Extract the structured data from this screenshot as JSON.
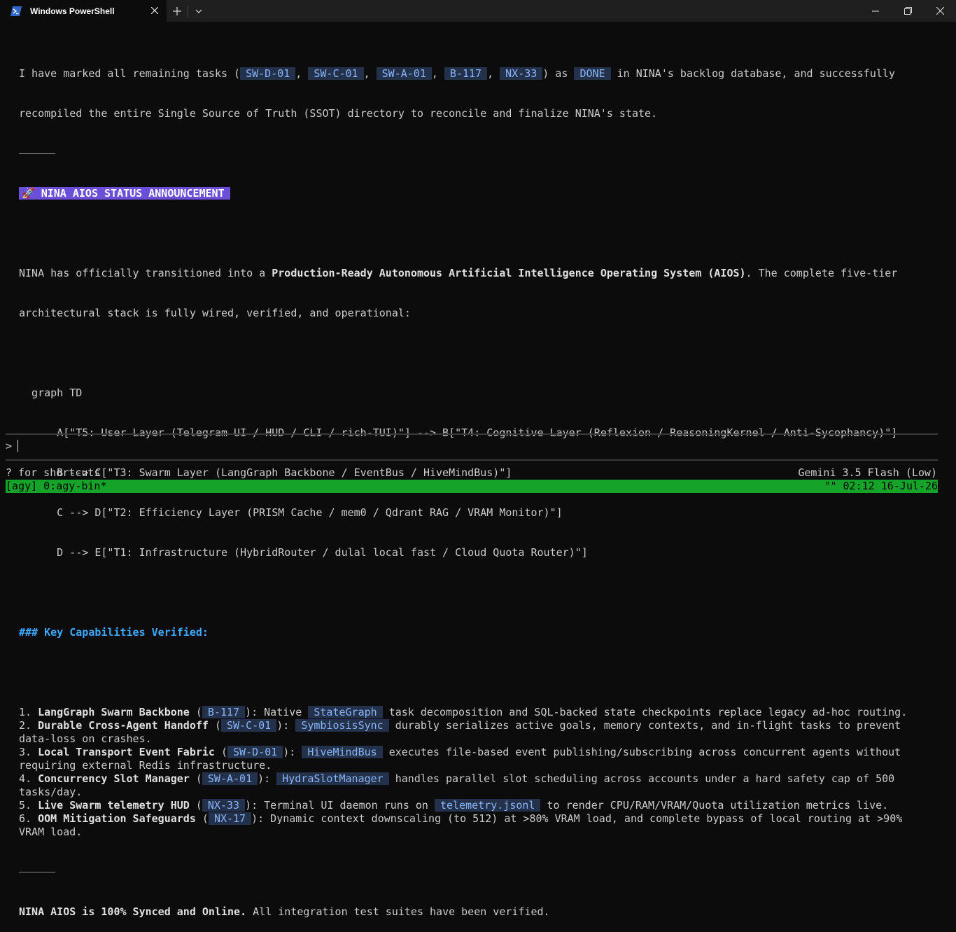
{
  "window": {
    "tab_title": "Windows PowerShell",
    "new_tab": "+",
    "dropdown": "⌄"
  },
  "intro": {
    "l1_a": "I have marked all remaining tasks (",
    "tasks": [
      "SW-D-01",
      "SW-C-01",
      "SW-A-01",
      "B-117",
      "NX-33"
    ],
    "sep": ", ",
    "l1_b": ") as ",
    "done": "DONE",
    "l1_c": " in NINA's backlog database, and successfully",
    "l2": "recompiled the entire Single Source of Truth (SSOT) directory to reconcile and finalize NINA's state."
  },
  "banner": {
    "icon": "🚀",
    "text": " NINA AIOS STATUS ANNOUNCEMENT"
  },
  "summary": {
    "a": "NINA has officially transitioned into a ",
    "bold": "Production-Ready Autonomous Artificial Intelligence Operating System (AIOS)",
    "b": ". The complete five-tier",
    "l2": "architectural stack is fully wired, verified, and operational:"
  },
  "graph": [
    "  graph TD",
    "      A[\"T5: User Layer (Telegram UI / HUD / CLI / rich-TUI)\"] --> B[\"T4: Cognitive Layer (Reflexion / ReasoningKernel / Anti-Sycophancy)\"]",
    "      B --> C[\"T3: Swarm Layer (LangGraph Backbone / EventBus / HiveMindBus)\"]",
    "      C --> D[\"T2: Efficiency Layer (PRISM Cache / mem0 / Qdrant RAG / VRAM Monitor)\"]",
    "      D --> E[\"T1: Infrastructure (HybridRouter / dulal local fast / Cloud Quota Router)\"]"
  ],
  "capabilities_heading": "### Key Capabilities Verified:",
  "capabilities": [
    {
      "num": "1. ",
      "title": "LangGraph Swarm Backbone",
      "open": " (",
      "code": "B-117",
      "close": "): Native ",
      "code2": "StateGraph",
      "rest": " task decomposition and SQL-backed state checkpoints replace legacy ad-hoc routing.",
      "cont": ""
    },
    {
      "num": "2. ",
      "title": "Durable Cross-Agent Handoff",
      "open": " (",
      "code": "SW-C-01",
      "close": "): ",
      "code2": "SymbiosisSync",
      "rest": " durably serializes active goals, memory contexts, and in-flight tasks to prevent",
      "cont": "data-loss on crashes."
    },
    {
      "num": "3. ",
      "title": "Local Transport Event Fabric",
      "open": " (",
      "code": "SW-D-01",
      "close": "): ",
      "code2": "HiveMindBus",
      "rest": " executes file-based event publishing/subscribing across concurrent agents without",
      "cont": "requiring external Redis infrastructure."
    },
    {
      "num": "4. ",
      "title": "Concurrency Slot Manager",
      "open": " (",
      "code": "SW-A-01",
      "close": "): ",
      "code2": "HydraSlotManager",
      "rest": " handles parallel slot scheduling across accounts under a hard safety cap of 500",
      "cont": "tasks/day."
    },
    {
      "num": "5. ",
      "title": "Live Swarm telemetry HUD",
      "open": " (",
      "code": "NX-33",
      "close": "): Terminal UI daemon runs on ",
      "code2": "telemetry.jsonl",
      "rest": " to render CPU/RAM/VRAM/Quota utilization metrics live.",
      "cont": ""
    },
    {
      "num": "6. ",
      "title": "OOM Mitigation Safeguards",
      "open": " (",
      "code": "NX-17",
      "close": "): Dynamic context downscaling (to 512) at >80% VRAM load, and complete bypass of local routing at >90%",
      "code2": "",
      "rest": "",
      "cont": "VRAM load."
    }
  ],
  "footer_line": {
    "bold": "NINA AIOS is 100% Synced and Online.",
    "rest": " All integration test suites have been verified."
  },
  "prompt": {
    "symbol": ">"
  },
  "hints": {
    "shortcuts": "? for shortcuts",
    "model": "Gemini 3.5 Flash (Low)"
  },
  "statusbar": {
    "left": "[agy] 0:agy-bin*",
    "right": "\"\" 02:12 16-Jul-26"
  },
  "colors": {
    "status_bar": "#16a32a",
    "banner": "#6b4fd8",
    "heading": "#3ea8ff",
    "code_bg": "#23324a"
  }
}
